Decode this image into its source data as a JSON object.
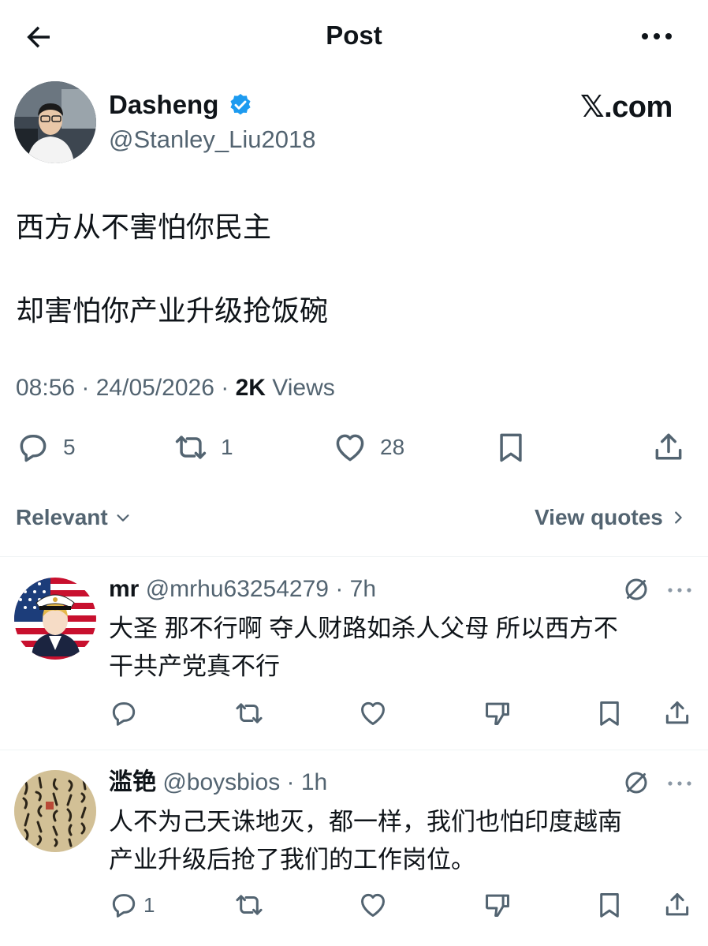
{
  "header": {
    "title": "Post",
    "back_icon": "back-arrow-icon",
    "more_icon": "more-horizontal-icon"
  },
  "post": {
    "author_name": "Dasheng",
    "author_handle": "@Stanley_Liu2018",
    "source_brand": "𝕏.com",
    "text_lines": [
      "西方从不害怕你民主",
      "却害怕你产业升级抢饭碗"
    ],
    "time": "08:56",
    "sep": " · ",
    "date": "24/05/2026",
    "views_count": "2K",
    "views_label": " Views",
    "replies": "5",
    "reposts": "1",
    "likes": "28"
  },
  "filters": {
    "sort_label": "Relevant",
    "quotes_label": "View quotes"
  },
  "replies": [
    {
      "name": "mr",
      "handle": "@mrhu63254279",
      "time": "7h",
      "text_lines": [
        "大圣 那不行啊 夺人财路如杀人父母 所以西方不",
        "干共产党真不行"
      ],
      "reply_count": ""
    },
    {
      "name": "滥铯",
      "handle": "@boysbios",
      "time": "1h",
      "text_lines": [
        "人不为己天诛地灭，都一样，我们也怕印度越南",
        "产业升级后抢了我们的工作岗位。"
      ],
      "reply_count": "1"
    }
  ],
  "colors": {
    "text": "#0f1419",
    "secondary": "#536471",
    "verified": "#1d9bf0",
    "divider": "#eff3f4"
  }
}
